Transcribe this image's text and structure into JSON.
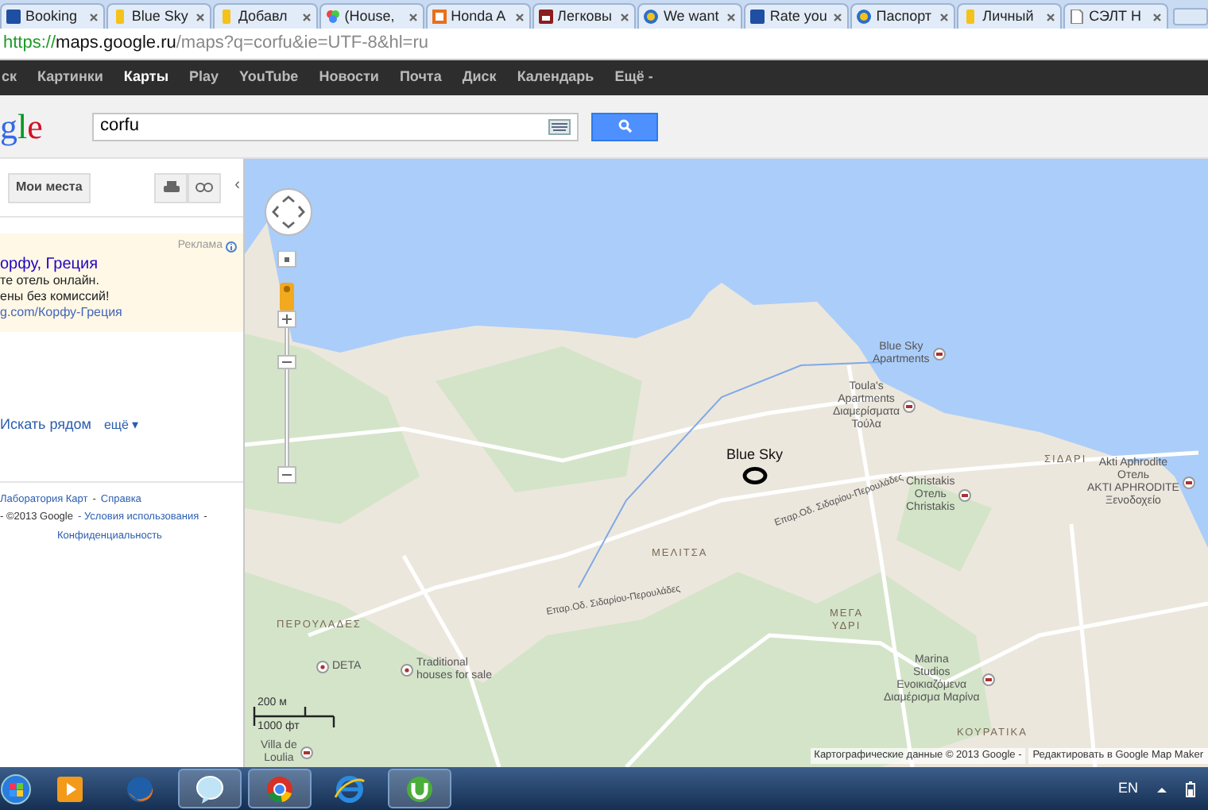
{
  "tabs": [
    {
      "label": "Booking",
      "kind": "square",
      "selected": false
    },
    {
      "label": "Blue Sky",
      "kind": "pin",
      "selected": false
    },
    {
      "label": "Добавл",
      "kind": "pin",
      "selected": false
    },
    {
      "label": "(House,",
      "kind": "dots",
      "selected": false
    },
    {
      "label": "Honda A",
      "kind": "framed",
      "selected": false
    },
    {
      "label": "Легковы",
      "kind": "car",
      "selected": false
    },
    {
      "label": "We want",
      "kind": "circle",
      "selected": false
    },
    {
      "label": "Rate you",
      "kind": "square",
      "selected": false
    },
    {
      "label": "Паспорт",
      "kind": "circle",
      "selected": false
    },
    {
      "label": "Личный",
      "kind": "pin",
      "selected": false
    },
    {
      "label": "СЭЛТ Н",
      "kind": "page",
      "selected": false
    }
  ],
  "address": {
    "scheme": "https://",
    "host": "maps.google.ru",
    "path": "/maps?q=corfu&ie=UTF-8&hl=ru"
  },
  "google_bar": [
    {
      "label": "ск",
      "selected": false
    },
    {
      "label": "Картинки",
      "selected": false
    },
    {
      "label": "Карты",
      "selected": true
    },
    {
      "label": "Play",
      "selected": false
    },
    {
      "label": "YouTube",
      "selected": false
    },
    {
      "label": "Новости",
      "selected": false
    },
    {
      "label": "Почта",
      "selected": false
    },
    {
      "label": "Диск",
      "selected": false
    },
    {
      "label": "Календарь",
      "selected": false
    },
    {
      "label": "Ещё -",
      "selected": false
    }
  ],
  "logo_text": "gle",
  "search": {
    "value": "corfu"
  },
  "sidebar": {
    "my_places": "Мои места",
    "collapse": "‹",
    "ad": {
      "badge": "Реклама",
      "title": "орфу, Греция",
      "lines": [
        "те отель онлайн.",
        "ены без комиссий!"
      ],
      "url": "g.com/Корфу-Греция"
    },
    "actions": [
      {
        "label": "Искать рядом"
      },
      {
        "label": "ещё ▾"
      }
    ],
    "footer": [
      [
        {
          "text": "Лаборатория Карт",
          "kind": "link"
        },
        {
          "text": "-",
          "kind": "text"
        },
        {
          "text": "Справка",
          "kind": "link"
        }
      ],
      [
        {
          "text": "- ©2013 Google",
          "kind": "text"
        },
        {
          "text": "- Условия использования",
          "kind": "link"
        },
        {
          "text": "-",
          "kind": "text"
        }
      ],
      [
        {
          "text": "Конфиденциальность",
          "kind": "link"
        }
      ]
    ]
  },
  "map": {
    "labels": [
      {
        "kind": "poi",
        "lines": [
          "Blue Sky",
          "Apartments"
        ]
      },
      {
        "kind": "poi",
        "lines": [
          "Toula's",
          "Apartments",
          "Διαμερίσματα",
          "Τούλα"
        ]
      },
      {
        "kind": "poi",
        "lines": [
          "Christakis",
          "Отель",
          "Christakis"
        ]
      },
      {
        "kind": "town",
        "lines": [
          "ΣΙΔΑΡΙ"
        ]
      },
      {
        "kind": "poi",
        "lines": [
          "Akti Aphrodite",
          "Отель",
          "AKTI APHRODITE",
          "Ξενοδοχείο"
        ]
      },
      {
        "kind": "marker",
        "lines": [
          "Blue Sky"
        ]
      },
      {
        "kind": "town",
        "lines": [
          "ΜΕΛΙΤΣΑ"
        ]
      },
      {
        "kind": "road",
        "lines": [
          "Επαρ.Οδ. Σιδαρίου-Περουλάδες"
        ]
      },
      {
        "kind": "road",
        "lines": [
          "Επαρ.Οδ. Σιδαρίου-Περουλάδες"
        ]
      },
      {
        "kind": "town",
        "lines": [
          "ΠΕΡΟΥΛΑΔΕΣ"
        ]
      },
      {
        "kind": "spot",
        "lines": [
          "DETA"
        ]
      },
      {
        "kind": "spot",
        "lines": [
          "Traditional",
          "houses for sale"
        ]
      },
      {
        "kind": "town",
        "lines": [
          "ΜΕΓΑ",
          "ΥΔΡΙ"
        ]
      },
      {
        "kind": "poi",
        "lines": [
          "Marina",
          "Studios",
          "Ενοικιαζόμενα",
          "Διαμέρισμα Μαρίνα"
        ]
      },
      {
        "kind": "town",
        "lines": [
          "ΚΟΥΡΑΤΙΚΑ"
        ]
      },
      {
        "kind": "poi",
        "lines": [
          "Villa de",
          "Loulia"
        ]
      }
    ],
    "scale": {
      "metric": "200 м",
      "imperial": "1000 фт"
    },
    "attribution": "Картографические данные © 2013 Google -",
    "edit_link": "Редактировать в Google Map Maker"
  },
  "taskbar": {
    "apps": [
      {
        "kind": "media",
        "running": false
      },
      {
        "kind": "firefox",
        "running": false
      },
      {
        "kind": "bubble",
        "running": true
      },
      {
        "kind": "chrome",
        "running": true
      },
      {
        "kind": "ie",
        "running": false
      },
      {
        "kind": "torrent",
        "running": true
      }
    ],
    "language": "EN"
  }
}
